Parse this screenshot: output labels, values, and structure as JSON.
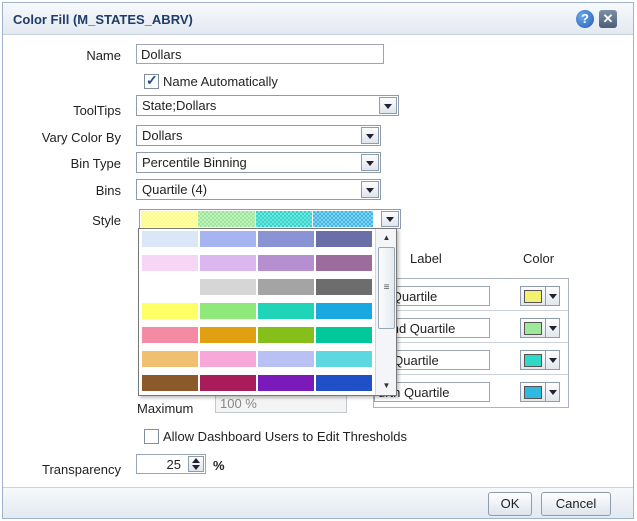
{
  "dialog": {
    "title": "Color Fill (M_STATES_ABRV)",
    "help_icon": "?",
    "close_icon": "✕"
  },
  "form": {
    "name_label": "Name",
    "name_value": "Dollars",
    "name_auto_label": "Name Automatically",
    "name_auto_checked": true,
    "tooltips_label": "ToolTips",
    "tooltips_value": "State;Dollars",
    "vary_label": "Vary Color By",
    "vary_value": "Dollars",
    "bintype_label": "Bin Type",
    "bintype_value": "Percentile Binning",
    "bins_label": "Bins",
    "bins_value": "Quartile (4)",
    "style_label": "Style",
    "style_colors": [
      "#fdfd84",
      "#9ee89a",
      "#2fd6cc",
      "#3fb8e6"
    ]
  },
  "style_dropdown": {
    "palettes": [
      [
        "#dbe6f7",
        "#a6b4f2",
        "#8a93d4",
        "#6a6fa8"
      ],
      [
        "#f6d6f4",
        "#dcb6ee",
        "#b68fd0",
        "#9b6c9c"
      ],
      [
        "#ffffff",
        "#d6d6d6",
        "#a4a4a4",
        "#6d6d6d"
      ],
      [
        "#ffff66",
        "#8ee87a",
        "#20d4b8",
        "#1aa8e0"
      ],
      [
        "#f48aa4",
        "#e0a010",
        "#86bf1a",
        "#00c89a"
      ],
      [
        "#f0c070",
        "#f8a8d8",
        "#b8c0f4",
        "#5ed8e0"
      ],
      [
        "#8a5a2a",
        "#a81c5a",
        "#7a1ab8",
        "#2050c8"
      ]
    ]
  },
  "thresholds": {
    "label_header": "Label",
    "color_header": "Color",
    "rows": [
      {
        "label": "st Quartile",
        "color": "#f4f070"
      },
      {
        "label": "cond Quartile",
        "color": "#9ee89a"
      },
      {
        "label": "rd Quartile",
        "color": "#30d8c8"
      },
      {
        "label": "urth Quartile",
        "color": "#30b8e0"
      }
    ],
    "maximum_label": "Maximum",
    "maximum_value": "100 %",
    "allow_edit_label": "Allow Dashboard Users to Edit Thresholds",
    "allow_edit_checked": false
  },
  "transparency": {
    "label": "Transparency",
    "value": "25",
    "unit": "%"
  },
  "buttons": {
    "ok": "OK",
    "cancel": "Cancel"
  }
}
